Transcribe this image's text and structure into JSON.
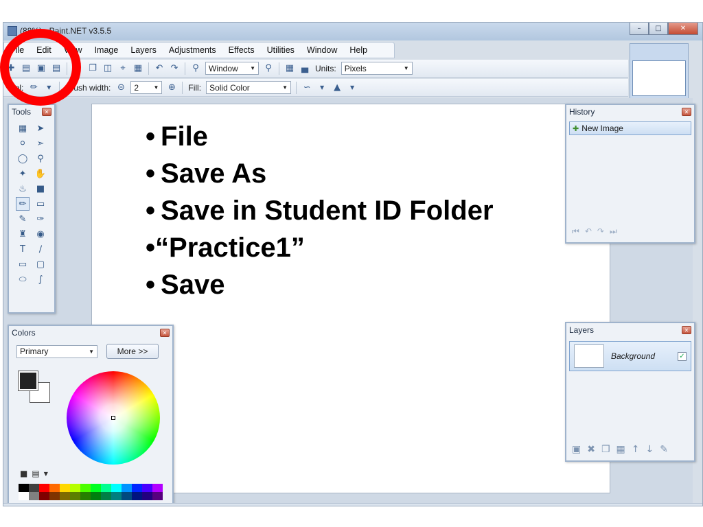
{
  "window": {
    "title": "(88%) - Paint.NET v3.5.5",
    "controls": [
      "minimize",
      "maximize",
      "close"
    ]
  },
  "menu": [
    "File",
    "Edit",
    "View",
    "Image",
    "Layers",
    "Adjustments",
    "Effects",
    "Utilities",
    "Window",
    "Help"
  ],
  "toolbar1": {
    "zoom_value": "Window",
    "units_label": "Units:",
    "units_value": "Pixels"
  },
  "toolbar2": {
    "tool_label": "Tool:",
    "brush_label": "Brush width:",
    "brush_value": "2",
    "fill_label": "Fill:",
    "fill_value": "Solid Color"
  },
  "tools_panel": {
    "title": "Tools"
  },
  "history_panel": {
    "title": "History",
    "items": [
      "New Image"
    ]
  },
  "layers_panel": {
    "title": "Layers",
    "layers": [
      {
        "name": "Background",
        "visible": true
      }
    ]
  },
  "colors_panel": {
    "title": "Colors",
    "mode": "Primary",
    "more_label": "More >>",
    "primary_color": "#222222",
    "secondary_color": "#ffffff"
  },
  "slide": {
    "bullets": [
      "File",
      "Save As",
      "Save in Student ID Folder",
      "“Practice1”",
      "Save"
    ],
    "highlight_color": "#ff0000"
  }
}
